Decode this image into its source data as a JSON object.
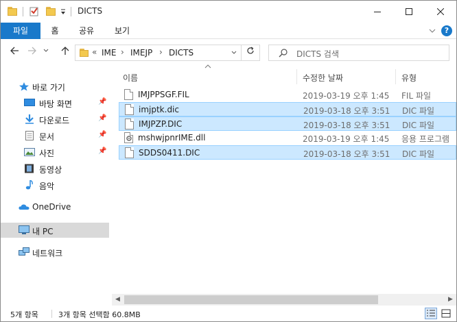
{
  "window": {
    "title": "DICTS"
  },
  "ribbon": {
    "tabs": [
      "파일",
      "홈",
      "공유",
      "보기"
    ],
    "help": "?"
  },
  "nav": {
    "breadcrumb_prefix": "«",
    "breadcrumb": [
      "IME",
      "IMEJP",
      "DICTS"
    ],
    "search_placeholder": "DICTS 검색"
  },
  "sidebar": {
    "quick_access": "바로 가기",
    "quick_items": [
      "바탕 화면",
      "다운로드",
      "문서",
      "사진",
      "동영상",
      "음악"
    ],
    "onedrive": "OneDrive",
    "this_pc": "내 PC",
    "network": "네트워크"
  },
  "columns": {
    "name": "이름",
    "modified": "수정한 날짜",
    "type": "유형"
  },
  "files": [
    {
      "name": "IMJPPSGF.FIL",
      "modified": "2019-03-19 오후 1:45",
      "type": "FIL 파일",
      "selected": false
    },
    {
      "name": "imjptk.dic",
      "modified": "2019-03-18 오후 3:51",
      "type": "DIC 파일",
      "selected": true
    },
    {
      "name": "IMJPZP.DIC",
      "modified": "2019-03-18 오후 3:51",
      "type": "DIC 파일",
      "selected": true
    },
    {
      "name": "mshwjpnrIME.dll",
      "modified": "2019-03-19 오후 1:45",
      "type": "응용 프로그램",
      "selected": false
    },
    {
      "name": "SDDS0411.DIC",
      "modified": "2019-03-18 오후 3:51",
      "type": "DIC 파일",
      "selected": true
    }
  ],
  "status": {
    "item_count": "5개 항목",
    "selection": "3개 항목 선택함 60.8MB"
  },
  "colors": {
    "accent": "#1979ca",
    "selection_bg": "#cce8ff",
    "selection_border": "#99d1ff",
    "folder": "#f3c94f"
  }
}
